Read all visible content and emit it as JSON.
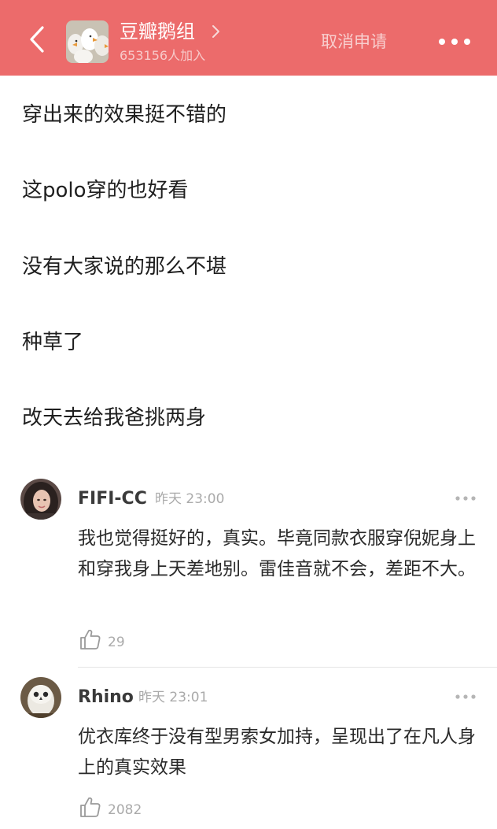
{
  "header": {
    "group_name": "豆瓣鹅组",
    "members": "653156人加入",
    "action": "取消申请"
  },
  "post": {
    "lines": [
      "穿出来的效果挺不错的",
      "这polo穿的也好看",
      "没有大家说的那么不堪",
      "种草了",
      "改天去给我爸挑两身"
    ]
  },
  "comments": [
    {
      "author": "FIFI-CC",
      "time": "昨天 23:00",
      "text": "我也觉得挺好的，真实。毕竟同款衣服穿倪妮身上和穿我身上天差地别。雷佳音就不会，差距不大。",
      "likes": "29"
    },
    {
      "author": "Rhino",
      "time": "昨天 23:01",
      "text": "优衣库终于没有型男索女加持，呈现出了在凡人身上的真实效果",
      "likes": "2082"
    }
  ],
  "colors": {
    "header_bg": "#ec6b6b",
    "muted_text": "#aaaaaa"
  },
  "icons": [
    "back-arrow-icon",
    "chevron-right-icon",
    "more-dots-icon",
    "thumbs-up-icon"
  ]
}
